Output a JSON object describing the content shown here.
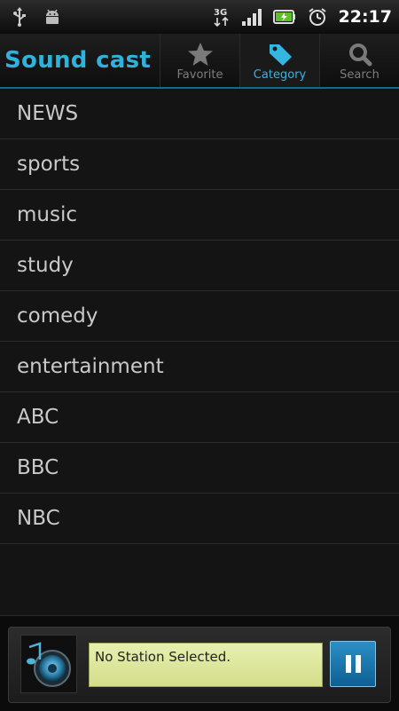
{
  "status_bar": {
    "time": "22:17",
    "network_type": "3G",
    "icons": [
      "usb-icon",
      "android-debug-icon",
      "signal-icon",
      "battery-icon",
      "alarm-icon"
    ]
  },
  "header": {
    "app_title": "Sound cast",
    "tabs": [
      {
        "label": "Favorite",
        "icon": "star-icon",
        "active": false
      },
      {
        "label": "Category",
        "icon": "tag-icon",
        "active": true
      },
      {
        "label": "Search",
        "icon": "search-icon",
        "active": false
      }
    ]
  },
  "categories": [
    "NEWS",
    "sports",
    "music",
    "study",
    "comedy",
    "entertainment",
    "ABC",
    "BBC",
    "NBC"
  ],
  "player": {
    "station_text": "No Station Selected.",
    "pause_label": "pause",
    "art_icon": "music-speaker-icon"
  },
  "colors": {
    "accent": "#2fb2dc",
    "background": "#141414",
    "station_field": "#d9e29a",
    "pause_button": "#1a78b0"
  }
}
